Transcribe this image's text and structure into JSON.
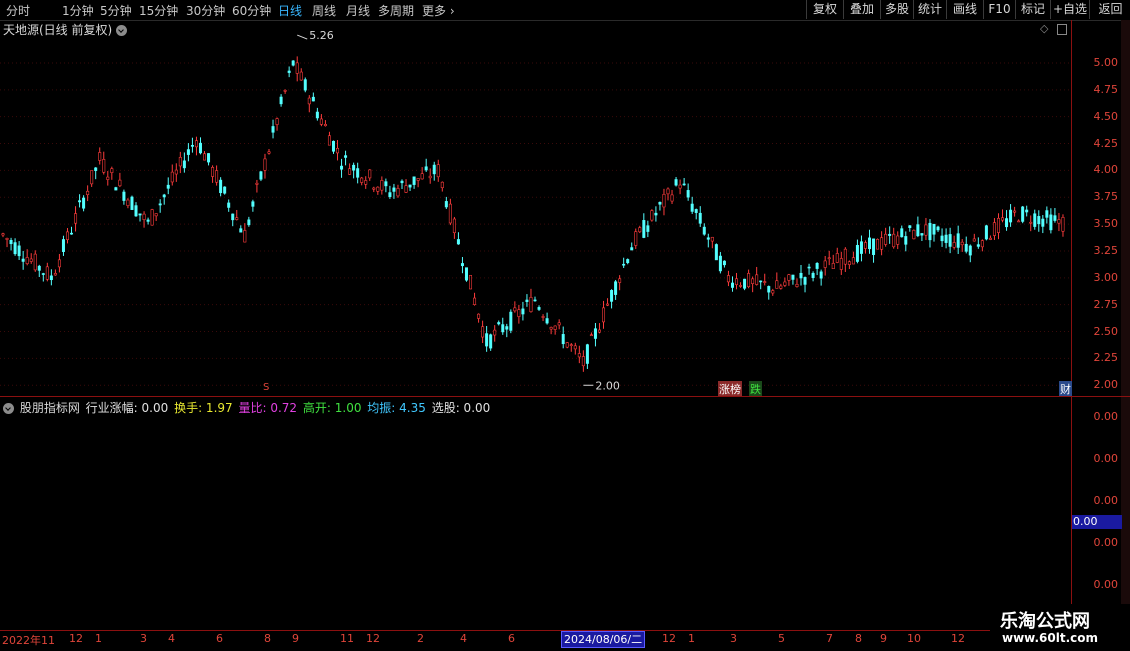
{
  "toolbar": {
    "periods": [
      "分时",
      "1分钟",
      "5分钟",
      "15分钟",
      "30分钟",
      "60分钟",
      "日线",
      "周线",
      "月线",
      "多周期",
      "更多"
    ],
    "active_period": "日线",
    "right_buttons": [
      "复权",
      "叠加",
      "多股",
      "统计",
      "画线",
      "F10",
      "+自选",
      "返回"
    ]
  },
  "main_panel": {
    "title": "天地源(日线 前复权)",
    "high_label": "5.26",
    "low_label": "2.00",
    "markers": {
      "limit_up": "涨榜",
      "down": "跌",
      "finance": "财",
      "sign": "S"
    }
  },
  "indicator_panel": {
    "name": "股朋指标网",
    "fields": [
      {
        "label": "行业涨幅:",
        "value": "0.00",
        "color": "#e0e0e0"
      },
      {
        "label": "换手:",
        "value": "1.97",
        "color": "#e8e830"
      },
      {
        "label": "量比:",
        "value": "0.72",
        "color": "#e040e0"
      },
      {
        "label": "高开:",
        "value": "1.00",
        "color": "#40e040"
      },
      {
        "label": "均振:",
        "value": "4.35",
        "color": "#40c8ff"
      },
      {
        "label": "选股:",
        "value": "0.00",
        "color": "#e0e0e0"
      }
    ],
    "axis_labels": [
      "0.00",
      "0.00",
      "0.00",
      "0.00",
      "0.00"
    ],
    "current_value": "0.00"
  },
  "date_axis": {
    "start": "2022年11",
    "ticks": [
      "12",
      "1",
      "3",
      "4",
      "6",
      "8",
      "9",
      "11",
      "12",
      "2",
      "4",
      "6",
      "12",
      "1",
      "3",
      "5",
      "7",
      "8",
      "9",
      "10",
      "12"
    ],
    "cursor_date": "2024/08/06/二"
  },
  "watermark": {
    "name": "乐淘公式网",
    "url": "www.60lt.com"
  },
  "chart_data": {
    "type": "line",
    "title": "天地源(日线 前复权)",
    "xlabel": "",
    "ylabel": "",
    "ylim": [
      1.9,
      5.4
    ],
    "y_ticks": [
      5.0,
      4.75,
      4.5,
      4.25,
      4.0,
      3.75,
      3.5,
      3.25,
      3.0,
      2.75,
      2.5,
      2.25,
      2.0
    ],
    "x": [
      "2022-11",
      "2022-12",
      "2023-01",
      "2023-03",
      "2023-04",
      "2023-06",
      "2023-08",
      "2023-09",
      "2023-11",
      "2023-12",
      "2024-02",
      "2024-04",
      "2024-06",
      "2024-08",
      "2024-12",
      "2025-01",
      "2025-03",
      "2025-05",
      "2025-07",
      "2025-08",
      "2025-09",
      "2025-10",
      "2025-12"
    ],
    "series": [
      {
        "values": [
          3.4,
          3.0,
          4.1,
          3.5,
          4.3,
          3.4,
          5.0,
          4.1,
          3.8,
          4.0,
          2.4,
          2.8,
          2.2,
          3.3,
          3.9,
          3.0,
          2.9,
          3.1,
          3.3,
          3.45,
          3.3,
          3.6,
          3.5
        ]
      }
    ],
    "annotations": [
      {
        "label": "5.26",
        "value": 5.26
      },
      {
        "label": "2.00",
        "value": 2.0
      }
    ]
  }
}
